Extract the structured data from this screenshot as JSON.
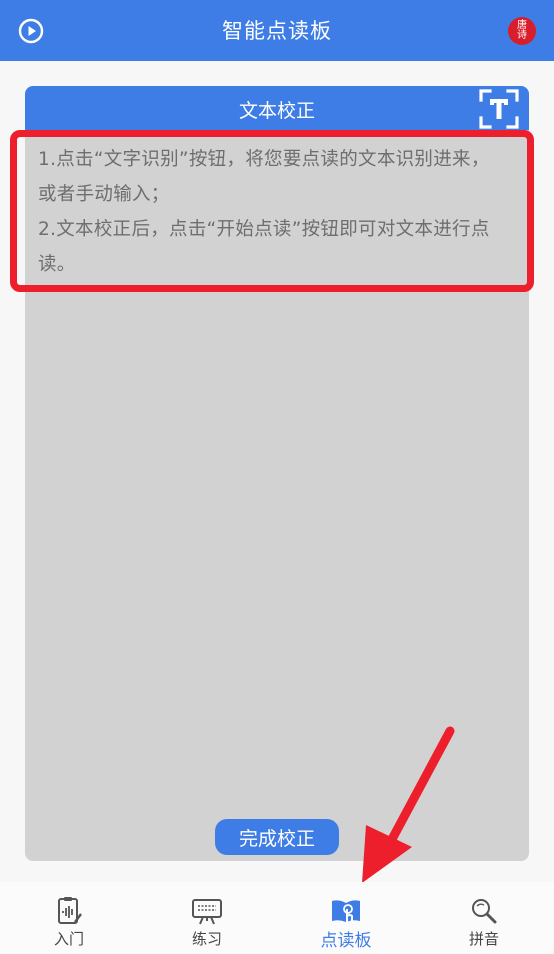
{
  "header": {
    "title": "智能点读板",
    "tangshi_line1": "唐",
    "tangshi_line2": "诗"
  },
  "card": {
    "title": "文本校正",
    "instructions": [
      "1.点击“文字识别”按钮，将您要点读的文本识别进来，",
      "或者手动输入；",
      "2.文本校正后，点击“开始点读”按钮即可对文本进行点",
      "读。"
    ],
    "done_label": "完成校正"
  },
  "tabs": [
    {
      "label": "入门",
      "icon": "clipboard-sound-icon",
      "active": false
    },
    {
      "label": "练习",
      "icon": "easel-board-icon",
      "active": false
    },
    {
      "label": "点读板",
      "icon": "book-touch-icon",
      "active": true
    },
    {
      "label": "拼音",
      "icon": "magnifier-icon",
      "active": false
    }
  ],
  "colors": {
    "primary": "#3f7de6",
    "annotation_red": "#ee1f2c",
    "text_area_bg": "#d2d2d2"
  }
}
